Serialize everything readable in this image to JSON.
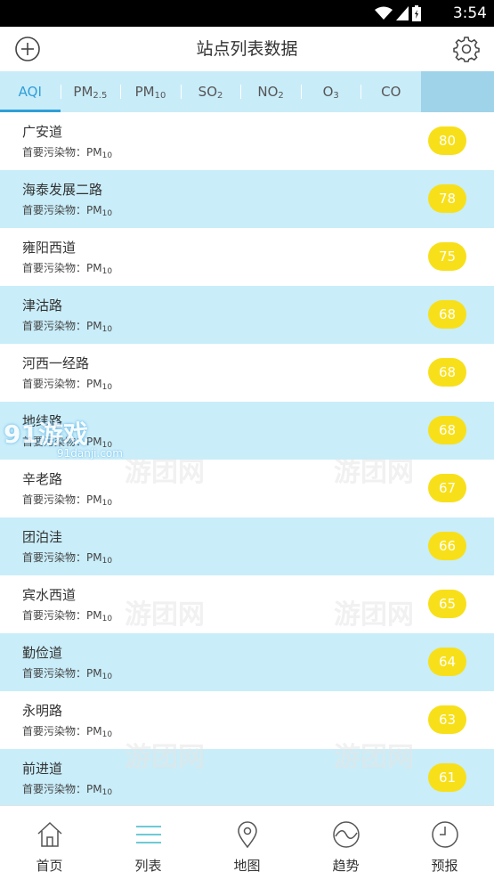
{
  "status_bar": {
    "time": "3:54"
  },
  "header": {
    "title": "站点列表数据"
  },
  "tabs": [
    {
      "label": "AQI",
      "sub": ""
    },
    {
      "label": "PM",
      "sub": "2.5"
    },
    {
      "label": "PM",
      "sub": "10"
    },
    {
      "label": "SO",
      "sub": "2"
    },
    {
      "label": "NO",
      "sub": "2"
    },
    {
      "label": "O",
      "sub": "3"
    },
    {
      "label": "CO",
      "sub": ""
    }
  ],
  "pollutant_prefix": "首要污染物：",
  "stations": [
    {
      "name": "广安道",
      "pollutant": "PM",
      "sub": "10",
      "aqi": "80"
    },
    {
      "name": "海泰发展二路",
      "pollutant": "PM",
      "sub": "10",
      "aqi": "78"
    },
    {
      "name": "雍阳西道",
      "pollutant": "PM",
      "sub": "10",
      "aqi": "75"
    },
    {
      "name": "津沽路",
      "pollutant": "PM",
      "sub": "10",
      "aqi": "68"
    },
    {
      "name": "河西一经路",
      "pollutant": "PM",
      "sub": "10",
      "aqi": "68"
    },
    {
      "name": "地纬路",
      "pollutant": "PM",
      "sub": "10",
      "aqi": "68"
    },
    {
      "name": "辛老路",
      "pollutant": "PM",
      "sub": "10",
      "aqi": "67"
    },
    {
      "name": "团泊洼",
      "pollutant": "PM",
      "sub": "10",
      "aqi": "66"
    },
    {
      "name": "宾水西道",
      "pollutant": "PM",
      "sub": "10",
      "aqi": "65"
    },
    {
      "name": "勤俭道",
      "pollutant": "PM",
      "sub": "10",
      "aqi": "64"
    },
    {
      "name": "永明路",
      "pollutant": "PM",
      "sub": "10",
      "aqi": "63"
    },
    {
      "name": "前进道",
      "pollutant": "PM",
      "sub": "10",
      "aqi": "61"
    }
  ],
  "watermarks": [
    "游团网",
    "游团网",
    "游团网",
    "游团网",
    "游团网",
    "游团网",
    "91游戏",
    "91danji.com"
  ],
  "nav": [
    {
      "label": "首页",
      "icon": "home-icon"
    },
    {
      "label": "列表",
      "icon": "list-icon"
    },
    {
      "label": "地图",
      "icon": "map-pin-icon"
    },
    {
      "label": "趋势",
      "icon": "trend-icon"
    },
    {
      "label": "预报",
      "icon": "clock-icon"
    }
  ],
  "colors": {
    "accent": "#2f9fd8",
    "row_highlight": "#c9edf9",
    "aqi_badge": "#f7e01a",
    "tab_bar": "#c9ecf9"
  }
}
